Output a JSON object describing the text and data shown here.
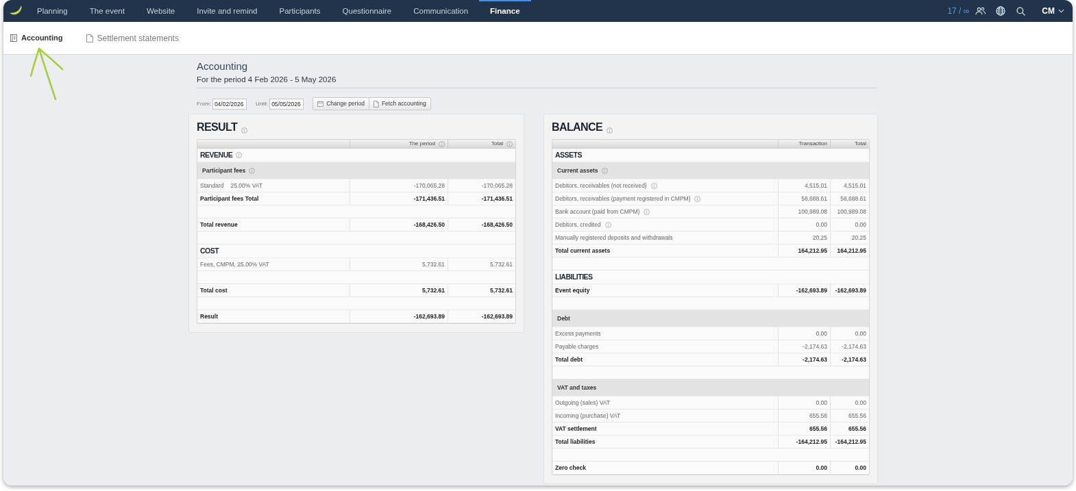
{
  "nav": {
    "items": [
      {
        "label": "Planning",
        "selected": false
      },
      {
        "label": "The event",
        "selected": false
      },
      {
        "label": "Website",
        "selected": false
      },
      {
        "label": "Invite and remind",
        "selected": false
      },
      {
        "label": "Participants",
        "selected": false
      },
      {
        "label": "Questionnaire",
        "selected": false
      },
      {
        "label": "Communication",
        "selected": false
      },
      {
        "label": "Finance",
        "selected": true
      }
    ],
    "quota": "17 / ∞",
    "user": "CM"
  },
  "subnav": {
    "tabs": [
      {
        "label": "Accounting",
        "selected": true
      },
      {
        "label": "Settlement statements",
        "selected": false
      }
    ]
  },
  "page": {
    "title": "Accounting",
    "subtitle": "For the period 4 Feb 2026 - 5 May 2026"
  },
  "period": {
    "from_label": "From:",
    "from": "04/02/2026",
    "until_label": "Until:",
    "until": "05/05/2026",
    "buttons": [
      "Change period",
      "Fetch accounting"
    ]
  },
  "result": {
    "title": "RESULT",
    "info": true,
    "columns": [
      {
        "label": "The period",
        "info": true
      },
      {
        "label": "Total",
        "info": true
      }
    ],
    "rows": [
      {
        "kind": "section",
        "label": "REVENUE",
        "info": true
      },
      {
        "kind": "group",
        "label": "Participant fees",
        "info": true
      },
      {
        "kind": "line",
        "label": "Standard",
        "vat": "25.00% VAT",
        "info": false,
        "values": [
          "-170,065.28",
          "-170,065.28"
        ]
      },
      {
        "kind": "total",
        "label": "Participant fees Total",
        "info": false,
        "values": [
          "-171,436.51",
          "-171,436.51"
        ]
      },
      {
        "kind": "spacer"
      },
      {
        "kind": "total",
        "label": "Total revenue",
        "info": false,
        "values": [
          "-168,426.50",
          "-168,426.50"
        ]
      },
      {
        "kind": "spacer"
      },
      {
        "kind": "section",
        "label": "COST",
        "info": false
      },
      {
        "kind": "line",
        "label": "Fees, CMPM, 25.00% VAT",
        "info": false,
        "values": [
          "5,732.61",
          "5,732.61"
        ]
      },
      {
        "kind": "spacer"
      },
      {
        "kind": "total",
        "label": "Total cost",
        "info": false,
        "values": [
          "5,732.61",
          "5,732.61"
        ]
      },
      {
        "kind": "spacer"
      },
      {
        "kind": "total",
        "label": "Result",
        "info": false,
        "values": [
          "-162,693.89",
          "-162,693.89"
        ]
      }
    ]
  },
  "balance": {
    "title": "BALANCE",
    "info": true,
    "columns": [
      {
        "label": "Transaction",
        "info": false
      },
      {
        "label": "Total",
        "info": false
      }
    ],
    "rows": [
      {
        "kind": "section",
        "label": "ASSETS",
        "info": false
      },
      {
        "kind": "group",
        "label": "Current assets",
        "info": true
      },
      {
        "kind": "line",
        "label": "Debitors, receivables (not received)",
        "info": true,
        "values": [
          "4,515.01",
          "4,515.01"
        ]
      },
      {
        "kind": "line",
        "label": "Debitors, receivables (payment registered in CMPM)",
        "info": true,
        "values": [
          "58,688.61",
          "58,688.61"
        ]
      },
      {
        "kind": "line",
        "label": "Bank account (paid from CMPM)",
        "info": true,
        "values": [
          "100,989.08",
          "100,989.08"
        ]
      },
      {
        "kind": "line",
        "label": "Debitors, credited",
        "info": true,
        "values": [
          "0.00",
          "0.00"
        ]
      },
      {
        "kind": "line",
        "label": "Manually registered deposits and withdrawals",
        "info": false,
        "values": [
          "20.25",
          "20.25"
        ]
      },
      {
        "kind": "total",
        "label": "Total current assets",
        "info": false,
        "values": [
          "164,212.95",
          "164,212.95"
        ]
      },
      {
        "kind": "spacer"
      },
      {
        "kind": "section",
        "label": "LIABILITIES",
        "info": false
      },
      {
        "kind": "total",
        "label": "Event equity",
        "info": false,
        "values": [
          "-162,693.89",
          "-162,693.89"
        ]
      },
      {
        "kind": "spacer"
      },
      {
        "kind": "group",
        "label": "Debt",
        "info": false
      },
      {
        "kind": "line",
        "label": "Excess payments",
        "info": false,
        "values": [
          "0.00",
          "0.00"
        ]
      },
      {
        "kind": "line",
        "label": "Payable charges",
        "info": false,
        "values": [
          "-2,174.63",
          "-2,174.63"
        ]
      },
      {
        "kind": "total",
        "label": "Total debt",
        "info": false,
        "values": [
          "-2,174.63",
          "-2,174.63"
        ]
      },
      {
        "kind": "spacer"
      },
      {
        "kind": "group",
        "label": "VAT and taxes",
        "info": false
      },
      {
        "kind": "line",
        "label": "Outgoing (sales) VAT",
        "info": false,
        "values": [
          "0.00",
          "0.00"
        ]
      },
      {
        "kind": "line",
        "label": "Incoming (purchase) VAT",
        "info": false,
        "values": [
          "655.56",
          "655.56"
        ]
      },
      {
        "kind": "total",
        "label": "VAT settlement",
        "info": false,
        "values": [
          "655.56",
          "655.56"
        ]
      },
      {
        "kind": "total",
        "label": "Total liabilities",
        "info": false,
        "values": [
          "-164,212.95",
          "-164,212.95"
        ]
      },
      {
        "kind": "spacer"
      },
      {
        "kind": "total",
        "label": "Zero check",
        "info": false,
        "values": [
          "0.00",
          "0.00"
        ]
      }
    ]
  }
}
